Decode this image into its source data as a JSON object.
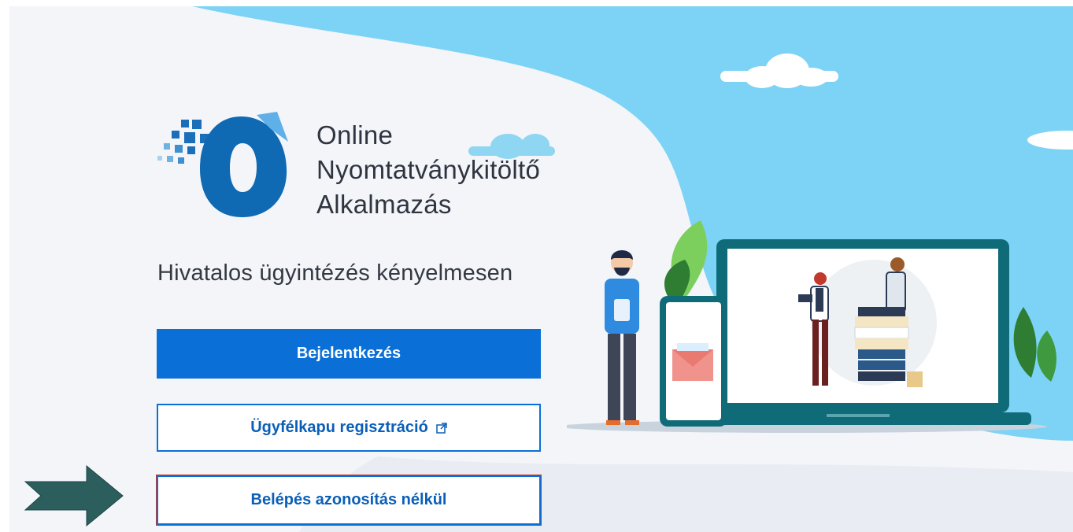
{
  "app": {
    "title_lines": [
      "Online",
      "Nyomtatványkitöltő",
      "Alkalmazás"
    ],
    "tagline": "Hivatalos ügyintézés kényelmesen"
  },
  "buttons": {
    "login": "Bejelentkezés",
    "register": "Ügyfélkapu regisztráció",
    "anonymous": "Belépés azonosítás nélkül"
  },
  "icons": {
    "logo": "online-o-logo-icon",
    "external": "external-link-icon",
    "arrow": "right-arrow-icon"
  },
  "colors": {
    "primary": "#0a6fd6",
    "sky": "#7dd3f5",
    "arrow": "#2d5e5e"
  }
}
